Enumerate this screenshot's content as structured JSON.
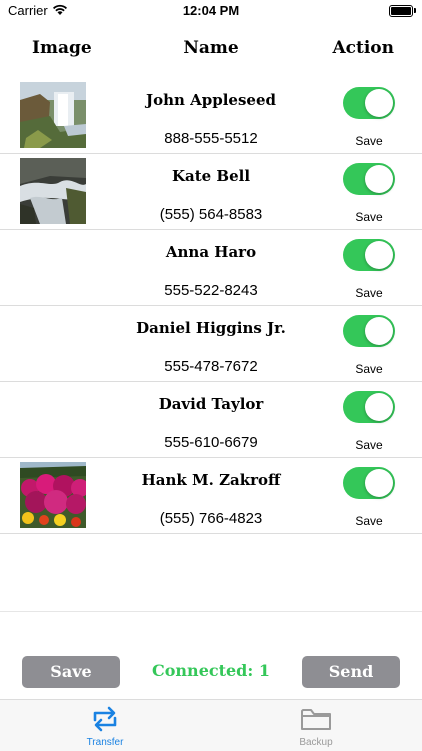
{
  "status_bar": {
    "carrier": "Carrier",
    "time": "12:04 PM"
  },
  "headers": {
    "image": "Image",
    "name": "Name",
    "action": "Action"
  },
  "contacts": [
    {
      "name": "John Appleseed",
      "phone": "888-555-5512",
      "image": "waterfall",
      "enabled": true,
      "action_label": "Save"
    },
    {
      "name": "Kate Bell",
      "phone": "(555) 564-8583",
      "image": "stream",
      "enabled": true,
      "action_label": "Save"
    },
    {
      "name": "Anna Haro",
      "phone": "555-522-8243",
      "image": "",
      "enabled": true,
      "action_label": "Save"
    },
    {
      "name": "Daniel Higgins Jr.",
      "phone": "555-478-7672",
      "image": "",
      "enabled": true,
      "action_label": "Save"
    },
    {
      "name": "David Taylor",
      "phone": "555-610-6679",
      "image": "",
      "enabled": true,
      "action_label": "Save"
    },
    {
      "name": "Hank M. Zakroff",
      "phone": "(555) 766-4823",
      "image": "flowers",
      "enabled": true,
      "action_label": "Save"
    }
  ],
  "footer": {
    "save_button": "Save",
    "connected_text": "Connected: 1",
    "send_button": "Send"
  },
  "tabbar": {
    "tabs": [
      {
        "label": "Transfer",
        "icon": "transfer-icon",
        "active": true
      },
      {
        "label": "Backup",
        "icon": "folder-icon",
        "active": false
      }
    ]
  },
  "colors": {
    "toggle_on": "#34c759",
    "accent": "#1a82e2",
    "button_gray": "#8e8e93"
  }
}
